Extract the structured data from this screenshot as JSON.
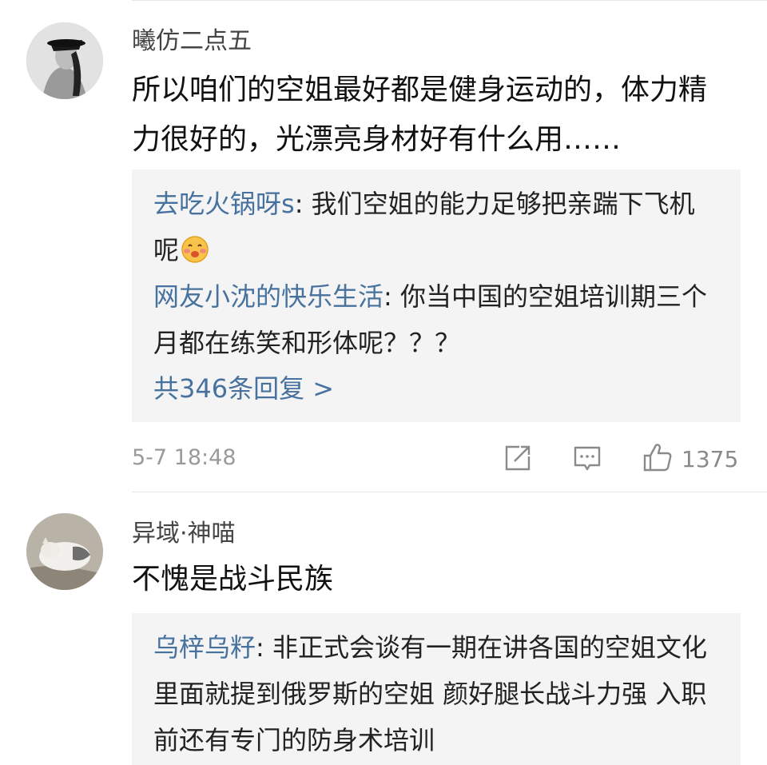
{
  "comments": [
    {
      "username": "曦仿二点五",
      "content": "所以咱们的空姐最好都是健身运动的，体力精力很好的，光漂亮身材好有什么用……",
      "replies": [
        {
          "name": "去吃火锅呀s",
          "sep": ": ",
          "text": "我们空姐的能力足够把亲踹下飞机呢"
        },
        {
          "name": "网友小沈的快乐生活",
          "sep": ": ",
          "text": "你当中国的空姐培训期三个月都在练笑和形体呢？？？"
        }
      ],
      "more_replies": "共346条回复 >",
      "time": "5-7 18:48",
      "like_count": "1375"
    },
    {
      "username": "异域·神喵",
      "content": "不愧是战斗民族",
      "replies": [
        {
          "name": "乌梓乌籽",
          "sep": ": ",
          "text": "非正式会谈有一期在讲各国的空姐文化 里面就提到俄罗斯的空姐 颜好腿长战斗力强 入职前还有专门的防身术培训"
        }
      ]
    }
  ],
  "icons": {
    "share": "share-icon",
    "comment": "comment-icon",
    "like": "thumbs-up-icon",
    "emoji": "blush-emoji-icon"
  },
  "colors": {
    "reply_name": "#47729e",
    "reply_bg": "#f4f4f4",
    "meta": "#9a9a9a"
  }
}
